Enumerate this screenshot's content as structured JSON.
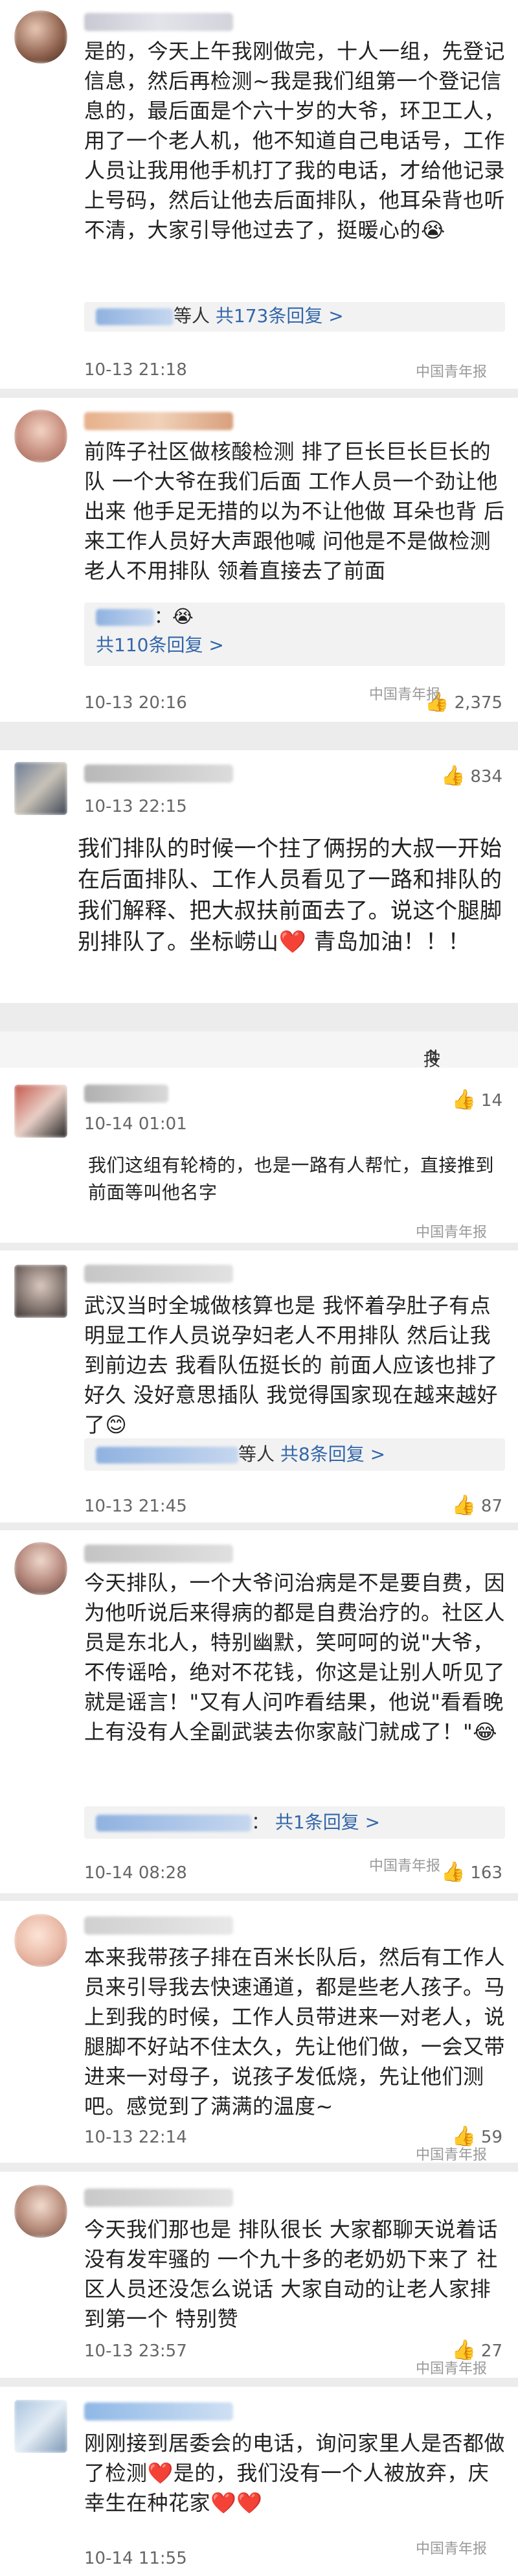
{
  "comments": [
    {
      "text": "是的，今天上午我刚做完，十人一组，先登记信息，然后再检测~我是我们组第一个登记信息的，最后面是个六十岁的大爷，环卫工人，用了一个老人机，他不知道自己电话号，工作人员让我用他手机打了我的电话，才给他记录上号码，然后让他去后面排队，他耳朵背也听不清，大家引导他过去了，挺暖心的😭",
      "reply_suffix": "等人",
      "reply_count": "共173条回复 >",
      "time": "10-13 21:18",
      "watermark": "中国青年报"
    },
    {
      "text": "前阵子社区做核酸检测 排了巨长巨长巨长的队 一个大爷在我们后面 工作人员一个劲让他出来 他手足无措的以为不让他做 耳朵也背 后来工作人员好大声跟他喊 问他是不是做检测 老人不用排队 领着直接去了前面",
      "reply_text": "：😭",
      "reply_count": "共110条回复 >",
      "time": "10-13 20:16",
      "likes": "2,375",
      "watermark": "中国青年报"
    },
    {
      "text": "我们排队的时候一个拄了俩拐的大叔一开始在后面排队、工作人员看见了一路和排队的我们解释、把大叔扶前面去了。说这个腿脚别排队了。坐标崂山❤️ 青岛加油！！！",
      "time": "10-13 22:15",
      "likes": "834"
    },
    {
      "text": "我们这组有轮椅的，也是一路有人帮忙，直接推到前面等叫他名字",
      "time": "10-14 01:01",
      "likes": "14",
      "watermark": "中国青年报"
    },
    {
      "text": "武汉当时全城做核算也是 我怀着孕肚子有点明显工作人员说孕妇老人不用排队 然后让我到前边去 我看队伍挺长的 前面人应该也排了好久 没好意思插队 我觉得国家现在越来越好了😊",
      "reply_suffix": "等人",
      "reply_count": "共8条回复 >",
      "time": "10-13 21:45",
      "likes": "87"
    },
    {
      "text": "今天排队，一个大爷问治病是不是要自费，因为他听说后来得病的都是自费治疗的。社区人员是东北人，特别幽默，笑呵呵的说\"大爷，不传谣哈，绝对不花钱，你这是让别人听见了就是谣言！\"又有人问咋看结果，他说\"看看晚上有没有人全副武装去你家敲门就成了！\"😂",
      "reply_suffix": "：",
      "reply_count": "共1条回复 >",
      "time": "10-14 08:28",
      "likes": "163",
      "watermark": "中国青年报"
    },
    {
      "text": "本来我带孩子排在百米长队后，然后有工作人员来引导我去快速通道，都是些老人孩子。马上到我的时候，工作人员带进来一对老人，说腿脚不好站不住太久，先让他们做，一会又带进来一对母子，说孩子发低烧，先让他们测吧。感觉到了满满的温度~",
      "time": "10-13 22:14",
      "likes": "59",
      "watermark": "中国青年报"
    },
    {
      "text": "今天我们那也是 排队很长 大家都聊天说着话 没有发牢骚的 一个九十多的老奶奶下来了 社区人员还没怎么说话 大家自动的让老人家排到第一个 特别赞",
      "time": "10-13 23:57",
      "likes": "27",
      "watermark": "中国青年报"
    },
    {
      "text": "刚刚接到居委会的电话，询问家里人是否都做了检测❤️是的，我们没有一个人被放弃，庆幸生在种花家❤️❤️",
      "time": "10-14 11:55",
      "watermark": "中国青年报"
    }
  ],
  "sort_label": "按时间",
  "icons": {
    "like": "thumbs-up-icon",
    "sort": "sort-icon"
  }
}
